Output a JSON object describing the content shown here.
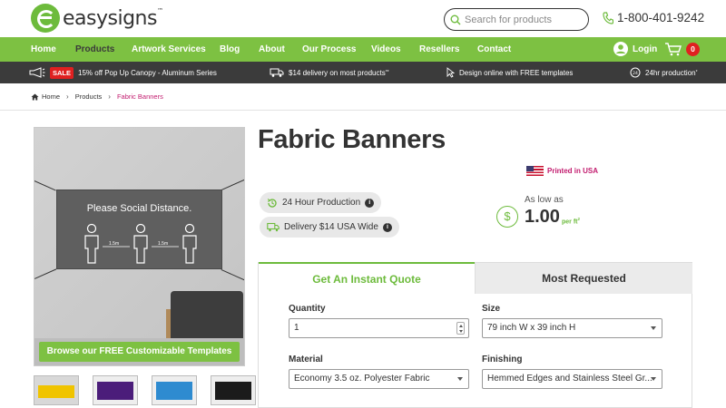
{
  "header": {
    "logo_text": "easysigns",
    "logo_mark": "™",
    "search_placeholder": "Search for products",
    "phone": "1-800-401-9242"
  },
  "nav": {
    "items": [
      "Home",
      "Products",
      "Artwork Services",
      "Blog",
      "About",
      "Our Process",
      "Videos",
      "Resellers",
      "Contact"
    ],
    "active": "Products",
    "login_label": "Login",
    "cart_count": "0"
  },
  "promo": {
    "sale_badge": "SALE",
    "sale_text": "15% off Pop Up Canopy - Aluminum Series",
    "delivery_text": "$14 delivery on most products",
    "delivery_mark": "**",
    "design_text": "Design online with FREE templates",
    "production_text": "24hr production",
    "production_mark": "*"
  },
  "breadcrumb": {
    "home": "Home",
    "products": "Products",
    "current": "Fabric Banners"
  },
  "product": {
    "title": "Fabric Banners",
    "printed_in": "Printed in USA",
    "badge_production": "24 Hour Production",
    "badge_delivery": "Delivery $14 USA Wide",
    "as_low_as": "As low as",
    "price": "1.00",
    "price_unit": "per ft",
    "price_unit_sup": "2",
    "image_banner_text": "Please Social Distance.",
    "distance_label": "1.5m",
    "templates_button": "Browse our FREE Customizable Templates"
  },
  "quote": {
    "tab_active": "Get An Instant Quote",
    "tab_inactive": "Most Requested",
    "quantity_label": "Quantity",
    "quantity_value": "1",
    "size_label": "Size",
    "size_value": "79 inch W x 39 inch H",
    "material_label": "Material",
    "material_value": "Economy 3.5 oz. Polyester Fabric",
    "finishing_label": "Finishing",
    "finishing_value": "Hemmed Edges and Stainless Steel Gr..."
  },
  "colors": {
    "brand_green": "#7dc142",
    "accent_magenta": "#c21b6e",
    "promo_bg": "#3b3b3b",
    "sale_red": "#e02020"
  }
}
